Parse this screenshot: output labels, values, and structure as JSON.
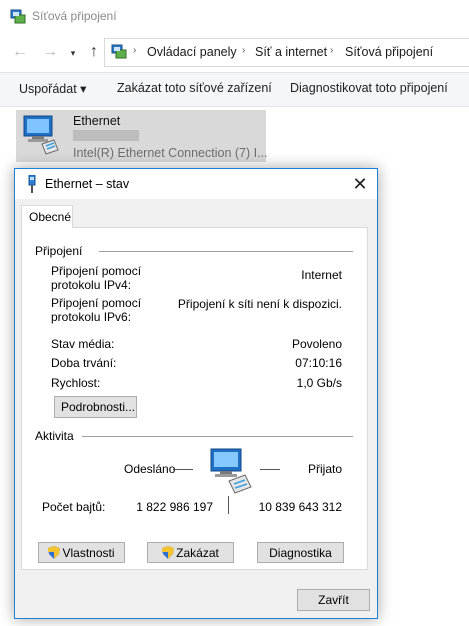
{
  "window": {
    "title": "Síťová připojení",
    "breadcrumb": [
      "Ovládací panely",
      "Síť a internet",
      "Síťová připojení"
    ]
  },
  "nav": {
    "back": "←",
    "forward": "→",
    "up": "↑",
    "sep": "›"
  },
  "commands": {
    "organize": "Uspořádat ▾",
    "disable_device": "Zakázat toto síťové zařízení",
    "diagnose": "Diagnostikovat toto připojení"
  },
  "adapter": {
    "name": "Ethernet",
    "description": "Intel(R) Ethernet Connection (7) I..."
  },
  "dialog": {
    "title": "Ethernet – stav",
    "close": "✕",
    "tab": "Obecné",
    "connection": {
      "heading": "Připojení",
      "ipv4_label": "Připojení pomocí protokolu IPv4:",
      "ipv4_value": "Internet",
      "ipv6_label": "Připojení pomocí protokolu IPv6:",
      "ipv6_value": "Připojení k síti není k dispozici.",
      "media_label": "Stav média:",
      "media_value": "Povoleno",
      "duration_label": "Doba trvání:",
      "duration_value": "07:10:16",
      "speed_label": "Rychlost:",
      "speed_value": "1,0 Gb/s",
      "details_button": "Podrobnosti..."
    },
    "activity": {
      "heading": "Aktivita",
      "sent_label": "Odesláno",
      "received_label": "Přijato",
      "bytes_label": "Počet bajtů:",
      "bytes_sent": "1 822 986 197",
      "bytes_received": "10 839 643 312"
    },
    "buttons": {
      "properties": "Vlastnosti",
      "disable": "Zakázat",
      "diagnose": "Diagnostika",
      "close": "Zavřít"
    }
  },
  "colors": {
    "accent": "#1883d7",
    "selection": "#d9d9d9",
    "dialog_bg": "#f0f0f0"
  },
  "icons": [
    "network-connections-icon",
    "network-adapter-icon",
    "ethernet-icon",
    "shield-icon",
    "computer-activity-icon"
  ]
}
